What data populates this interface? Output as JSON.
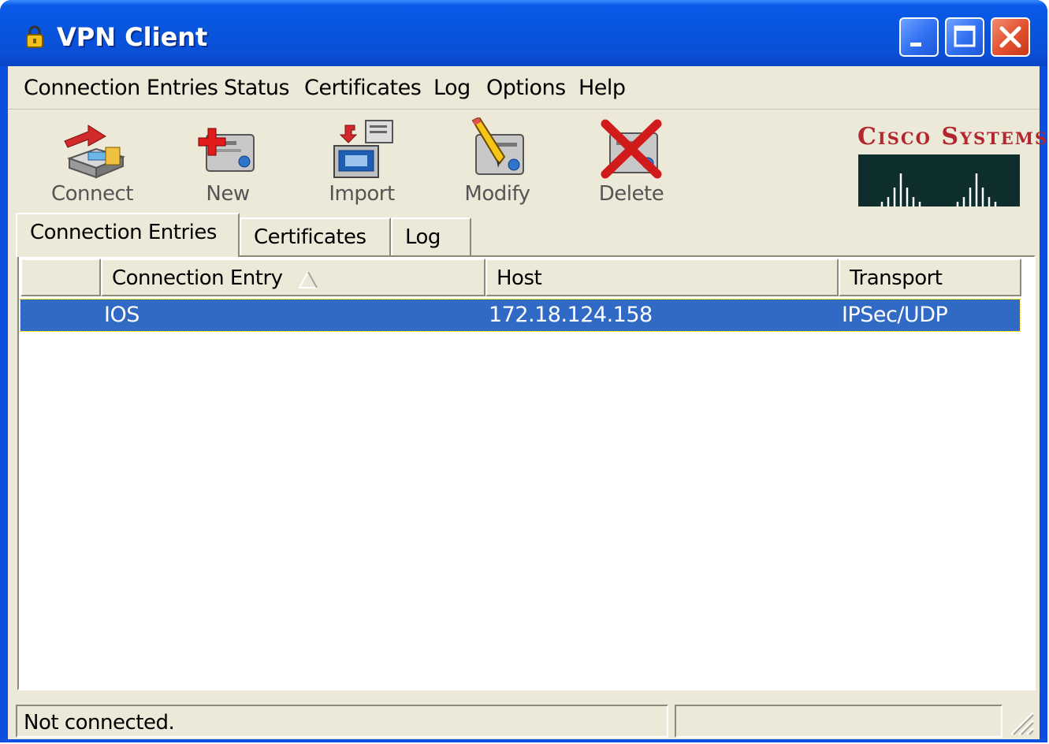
{
  "window": {
    "title": "VPN Client"
  },
  "menu": {
    "items": [
      "Connection Entries",
      "Status",
      "Certificates",
      "Log",
      "Options",
      "Help"
    ]
  },
  "toolbar": {
    "connect_label": "Connect",
    "new_label": "New",
    "import_label": "Import",
    "modify_label": "Modify",
    "delete_label": "Delete"
  },
  "brand": {
    "logo_text": "Cisco Systems"
  },
  "tabs": [
    {
      "label": "Connection Entries",
      "active": true
    },
    {
      "label": "Certificates",
      "active": false
    },
    {
      "label": "Log",
      "active": false
    }
  ],
  "table": {
    "columns": [
      "",
      "Connection Entry",
      "Host",
      "Transport"
    ],
    "rows": [
      {
        "entry": "IOS",
        "host": "172.18.124.158",
        "transport": "IPSec/UDP",
        "selected": true
      }
    ]
  },
  "status": {
    "text": "Not connected.",
    "secondary": ""
  },
  "colors": {
    "titlebar": "#0a55dd",
    "selection": "#316ac5",
    "face": "#ece9d8",
    "cisco_red": "#b3262e"
  }
}
